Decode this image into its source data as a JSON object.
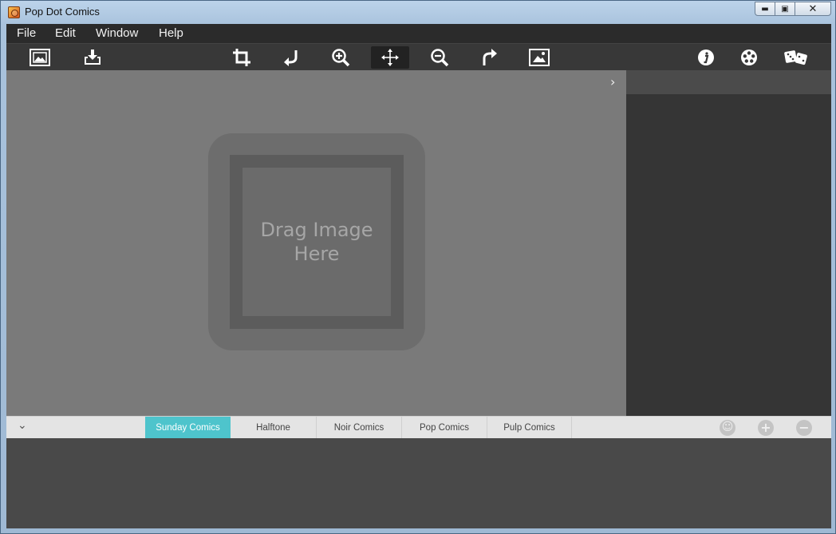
{
  "window": {
    "title": "Pop Dot Comics",
    "min_glyph": "▬",
    "max_glyph": "▣",
    "close_glyph": "✕"
  },
  "menu": {
    "file": "File",
    "edit": "Edit",
    "window": "Window",
    "help": "Help"
  },
  "toolbar": {
    "tools": [
      "open-image",
      "save-export",
      "crop",
      "rotate-left",
      "zoom-in",
      "pan-move",
      "zoom-out",
      "rotate-right",
      "fit-image",
      "info",
      "settings",
      "randomize"
    ],
    "active_tool": "pan-move"
  },
  "canvas": {
    "drop_text": "Drag Image Here",
    "expand_glyph": "›"
  },
  "presets": {
    "collapse_glyph": "⌄",
    "tabs": [
      "Sunday Comics",
      "Halftone",
      "Noir Comics",
      "Pop Comics",
      "Pulp Comics"
    ],
    "active_tab": "Sunday Comics",
    "add_glyph": "+",
    "remove_glyph": "−",
    "favorite_glyph": "☺"
  },
  "colors": {
    "accent": "#4ec4cc",
    "canvas_bg": "#7a7a7a",
    "panel_bg": "#353535",
    "toolbar_bg": "#383838"
  }
}
